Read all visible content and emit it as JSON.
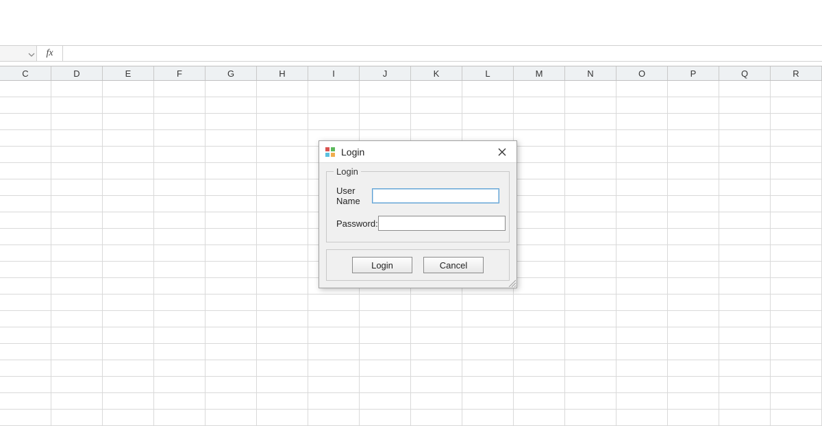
{
  "formula_bar": {
    "fx_label": "fx",
    "value": ""
  },
  "columns": [
    "C",
    "D",
    "E",
    "F",
    "G",
    "H",
    "I",
    "J",
    "K",
    "L",
    "M",
    "N",
    "O",
    "P",
    "Q",
    "R"
  ],
  "dialog": {
    "title": "Login",
    "group_legend": "Login",
    "username_label": "User Name",
    "password_label": "Password:",
    "username_value": "",
    "password_value": "",
    "login_button": "Login",
    "cancel_button": "Cancel"
  }
}
